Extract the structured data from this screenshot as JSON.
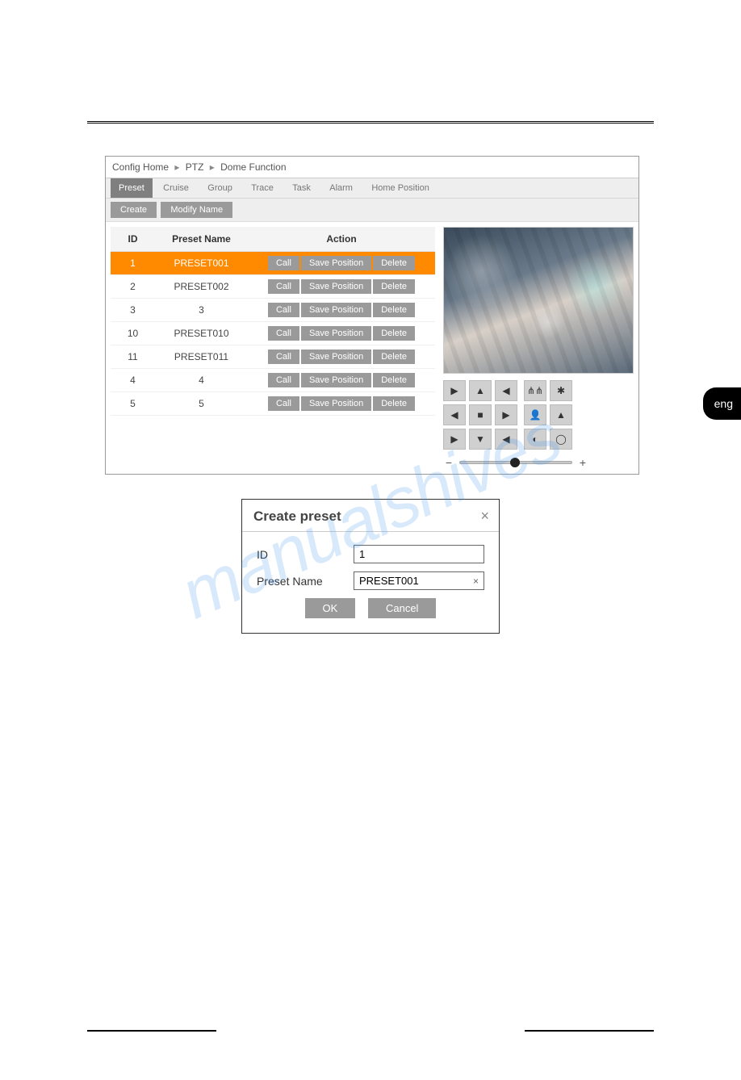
{
  "sideTag": "eng",
  "watermark": "manualshives",
  "breadcrumb": {
    "a": "Config Home",
    "b": "PTZ",
    "c": "Dome Function",
    "sep": "▸"
  },
  "tabs": [
    "Preset",
    "Cruise",
    "Group",
    "Trace",
    "Task",
    "Alarm",
    "Home Position"
  ],
  "activeTabIndex": 0,
  "toolbar": {
    "create": "Create",
    "modify": "Modify Name"
  },
  "table": {
    "headers": {
      "id": "ID",
      "name": "Preset Name",
      "action": "Action"
    },
    "actions": {
      "call": "Call",
      "save": "Save Position",
      "del": "Delete"
    },
    "rows": [
      {
        "id": "1",
        "name": "PRESET001",
        "selected": true
      },
      {
        "id": "2",
        "name": "PRESET002",
        "selected": false
      },
      {
        "id": "3",
        "name": "3",
        "selected": false
      },
      {
        "id": "10",
        "name": "PRESET010",
        "selected": false
      },
      {
        "id": "11",
        "name": "PRESET011",
        "selected": false
      },
      {
        "id": "4",
        "name": "4",
        "selected": false
      },
      {
        "id": "5",
        "name": "5",
        "selected": false
      }
    ]
  },
  "ptzDir": [
    "▶",
    "▲",
    "◀",
    "◀",
    "■",
    "▶",
    "▶",
    "▼",
    "◀"
  ],
  "ptzAux": [
    "⋔⋔",
    "✱",
    "👤",
    "▲",
    "◐",
    "◯"
  ],
  "slider": {
    "minus": "−",
    "plus": "+"
  },
  "dialog": {
    "title": "Create preset",
    "close": "×",
    "idLabel": "ID",
    "idValue": "1",
    "nameLabel": "Preset Name",
    "nameValue": "PRESET001",
    "clear": "×",
    "ok": "OK",
    "cancel": "Cancel"
  }
}
